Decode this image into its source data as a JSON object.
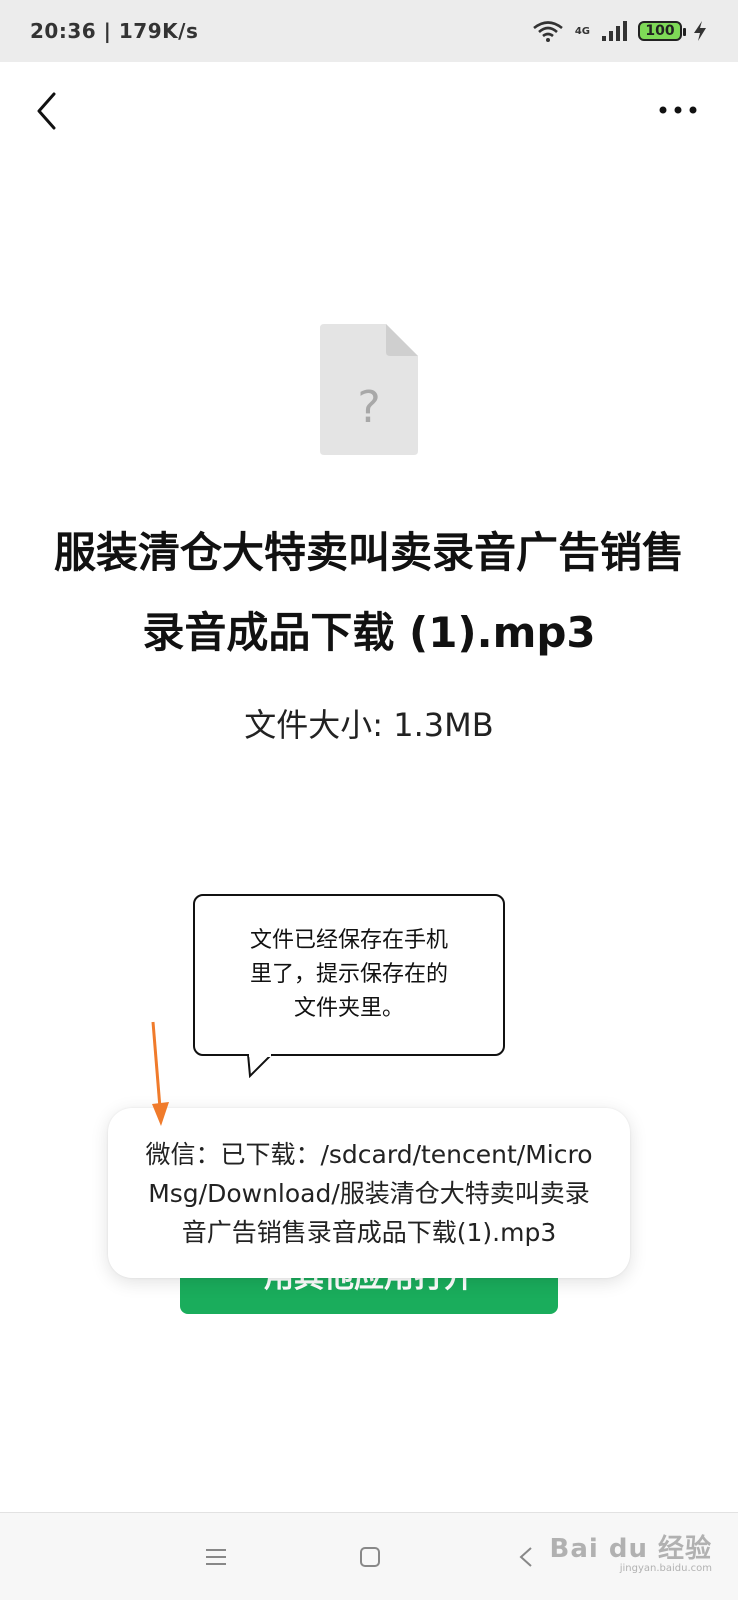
{
  "status_bar": {
    "time_speed": "20:36 | 179K/s",
    "network": "4G",
    "battery": "100"
  },
  "file": {
    "title": "服装清仓大特卖叫卖录音广告销售录音成品下载 (1).mp3",
    "size_label": "文件大小: 1.3MB",
    "icon_glyph": "?"
  },
  "open_button": {
    "label": "用其他应用打开"
  },
  "callout": {
    "text": "文件已经保存在手机里了，提示保存在的文件夹里。"
  },
  "toast": {
    "text": "微信：已下载：/sdcard/tencent/MicroMsg/Download/服装清仓大特卖叫卖录音广告销售录音成品下载(1).mp3"
  },
  "watermark": {
    "logo": "Bai du 经验",
    "sub": "jingyan.baidu.com"
  },
  "colors": {
    "accent_green": "#1aad5c",
    "annotation_arrow": "#f07b2b",
    "battery_fill": "#7ed957"
  },
  "icons": {
    "back": "chevron-left-icon",
    "more": "more-horizontal-icon",
    "file": "unknown-file-icon",
    "wifi": "wifi-icon",
    "signal": "cellular-signal-icon",
    "charging": "bolt-icon",
    "nav_menu": "menu-icon",
    "nav_home": "square-home-icon",
    "nav_back": "triangle-back-icon"
  }
}
